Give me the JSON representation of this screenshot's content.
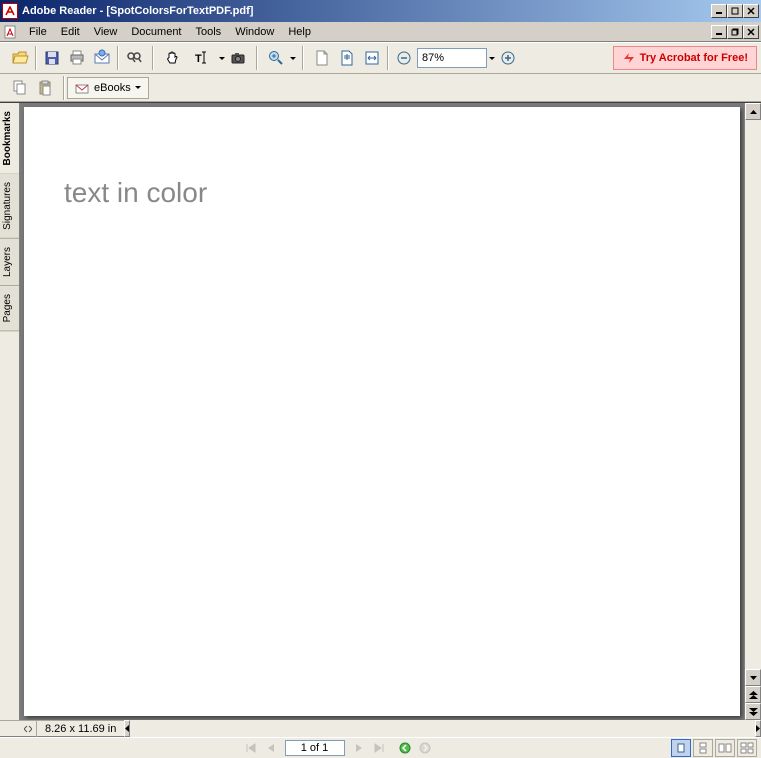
{
  "titlebar": {
    "app_name": "Adobe Reader",
    "doc_name": "[SpotColorsForTextPDF.pdf]"
  },
  "menu": {
    "items": [
      "File",
      "Edit",
      "View",
      "Document",
      "Tools",
      "Window",
      "Help"
    ]
  },
  "toolbar": {
    "zoom_value": "87%",
    "promo_text": "Try Acrobat for Free!"
  },
  "toolbar2": {
    "ebooks_label": "eBooks"
  },
  "side_tabs": {
    "items": [
      "Bookmarks",
      "Signatures",
      "Layers",
      "Pages"
    ]
  },
  "document": {
    "page_text": "text in color"
  },
  "status": {
    "dimensions": "8.26 x 11.69 in"
  },
  "nav": {
    "page_indicator": "1 of 1"
  }
}
